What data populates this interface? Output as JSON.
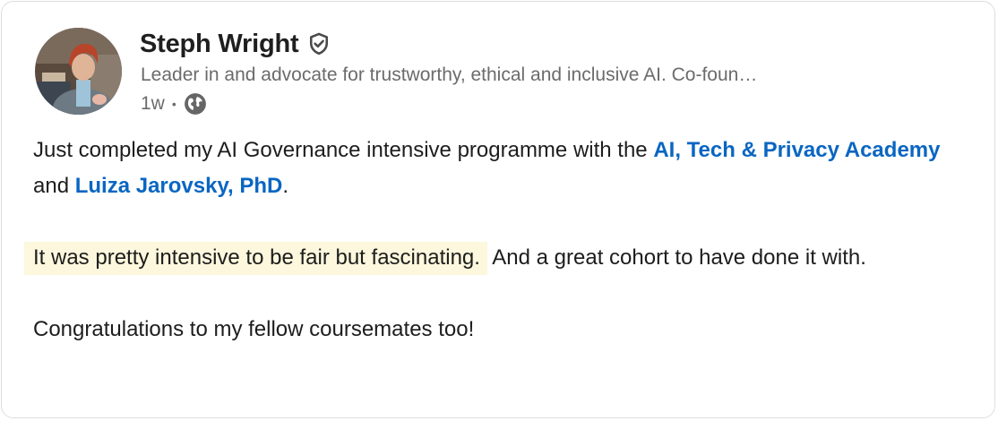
{
  "post": {
    "author": {
      "name": "Steph Wright",
      "headline": "Leader in and advocate for trustworthy, ethical and inclusive AI. Co-foun…",
      "verified_icon": "shield-check-icon"
    },
    "meta": {
      "time": "1w",
      "separator": "•",
      "visibility_icon": "globe-icon"
    },
    "body": {
      "p1_text1": "Just completed my AI Governance intensive programme with the ",
      "mention1": "AI, Tech & Privacy Academy",
      "p1_text2": " and ",
      "mention2": "Luiza Jarovsky, PhD",
      "p1_text3": ".",
      "p2_highlight": "It was pretty intensive to be fair but fascinating.",
      "p2_text": " And a great cohort to have done it with.",
      "p3": "Congratulations to my fellow coursemates too!"
    },
    "colors": {
      "mention": "#0a66c2",
      "highlight": "#fdf7dd",
      "secondary_text": "#6b6b6b"
    }
  }
}
